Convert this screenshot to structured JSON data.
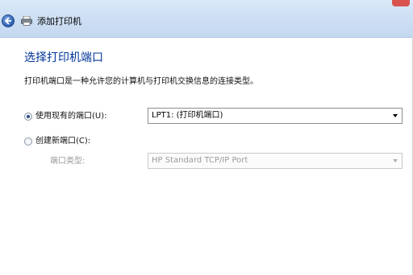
{
  "window": {
    "title": "添加打印机"
  },
  "page": {
    "heading": "选择打印机端口",
    "description": "打印机端口是一种允许您的计算机与打印机交换信息的连接类型。"
  },
  "options": {
    "use_existing": {
      "label": "使用现有的端口(U):",
      "checked": true,
      "selected_value": "LPT1: (打印机端口)"
    },
    "create_new": {
      "label": "创建新端口(C):",
      "checked": false,
      "port_type_label": "端口类型:",
      "port_type_value": "HP Standard TCP/IP Port"
    }
  },
  "icons": {
    "back": "back-arrow-icon",
    "printer": "printer-icon",
    "dropdown": "chevron-down-icon"
  },
  "colors": {
    "heading": "#003399",
    "titlebar": "#cfe0f4",
    "disabled_text": "#9b9b9b"
  }
}
